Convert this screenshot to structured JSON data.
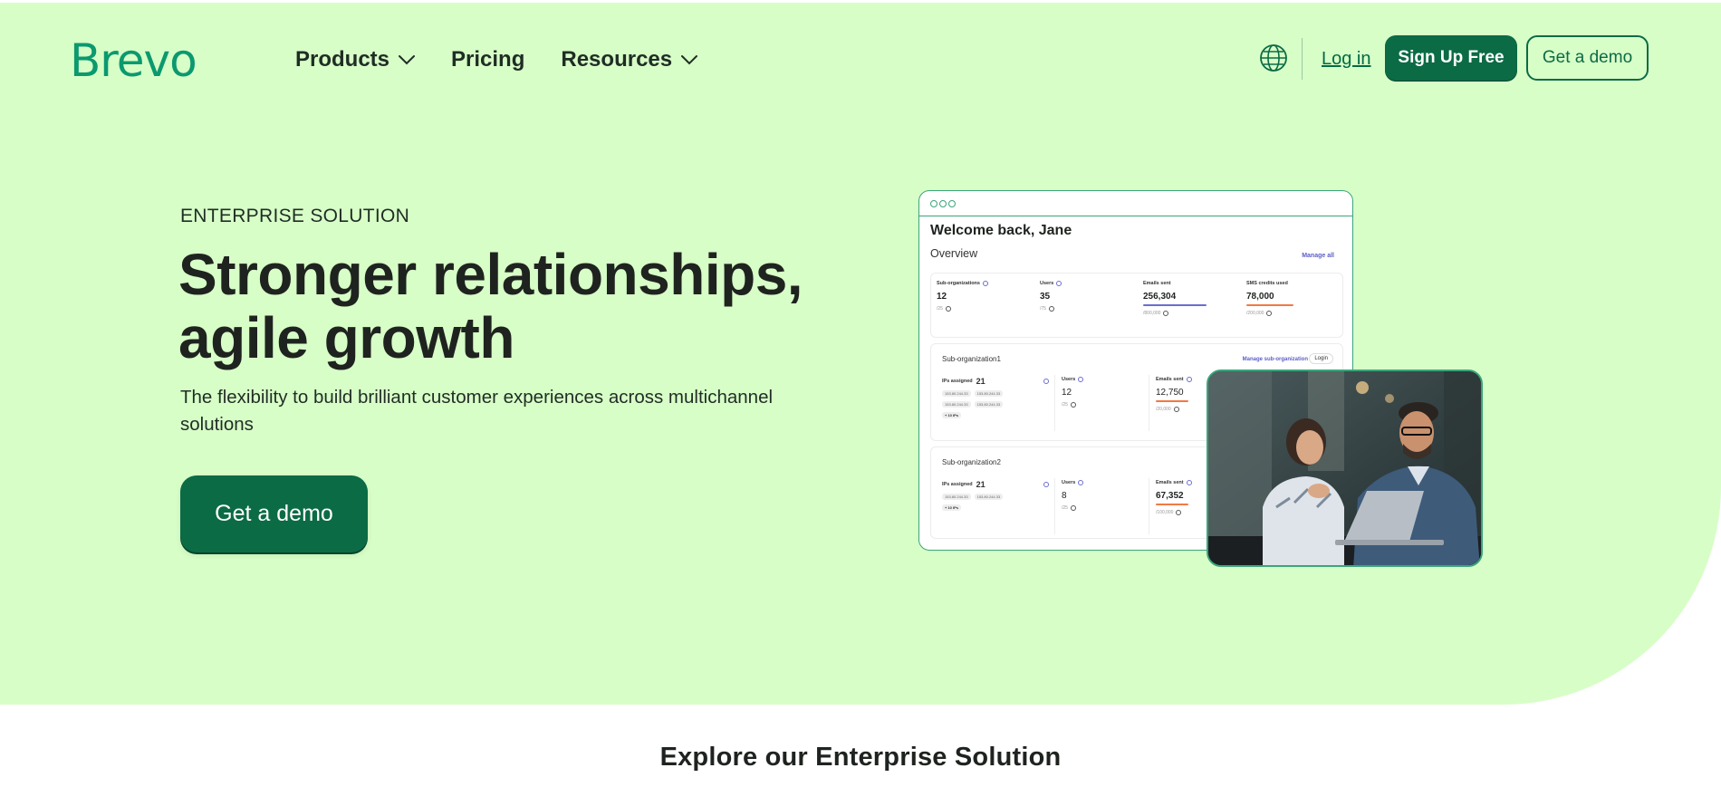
{
  "header": {
    "logo_text": "Brevo",
    "nav": [
      {
        "label": "Products",
        "has_dropdown": true
      },
      {
        "label": "Pricing",
        "has_dropdown": false
      },
      {
        "label": "Resources",
        "has_dropdown": true
      }
    ],
    "login_label": "Log in",
    "signup_label": "Sign Up Free",
    "demo_label": "Get a demo"
  },
  "hero": {
    "eyebrow": "ENTERPRISE SOLUTION",
    "headline_line1": "Stronger relationships,",
    "headline_line2": "agile growth",
    "subtext": "The flexibility to build brilliant customer experiences across multichannel solutions",
    "cta_label": "Get a demo"
  },
  "dashboard": {
    "welcome": "Welcome back, Jane",
    "overview": "Overview",
    "manage_all": "Manage all",
    "stats": [
      {
        "label": "Sub-organizations",
        "value": "12",
        "sub": "/25"
      },
      {
        "label": "Users",
        "value": "35",
        "sub": "/75"
      },
      {
        "label": "Emails sent",
        "value": "256,304",
        "sub": "/800,000"
      },
      {
        "label": "SMS credits used",
        "value": "78,000",
        "sub": "/200,000"
      }
    ],
    "orgs": [
      {
        "name": "Sub-organization1",
        "manage": "Manage sub-organization",
        "login": "Login",
        "ips_label": "IPs assigned",
        "ips_value": "21",
        "ips_row1": [
          "153.80.244.33",
          "153.80.244.33"
        ],
        "ips_row2": [
          "153.80.244.33",
          "153.80.244.33"
        ],
        "ips_more": "+ 10 IPs",
        "users_label": "Users",
        "users_value": "12",
        "users_sub": "/25",
        "emails_label": "Emails sent",
        "emails_value": "12,750",
        "emails_sub": "/20,000"
      },
      {
        "name": "Sub-organization2",
        "ips_label": "IPs assigned",
        "ips_value": "21",
        "ips_row1": [
          "153.80.244.33",
          "153.80.244.33"
        ],
        "ips_more": "+ 10 IPs",
        "users_label": "Users",
        "users_value": "8",
        "users_sub": "/25",
        "emails_label": "Emails sent",
        "emails_value": "67,352",
        "emails_sub": "/100,000"
      }
    ]
  },
  "explore_title": "Explore our Enterprise Solution",
  "colors": {
    "hero_bg": "#d8fec8",
    "brand_green": "#0b6b45",
    "logo_green": "#0b996e",
    "accent_purple": "#5b5fc7",
    "accent_orange": "#f07a43"
  }
}
